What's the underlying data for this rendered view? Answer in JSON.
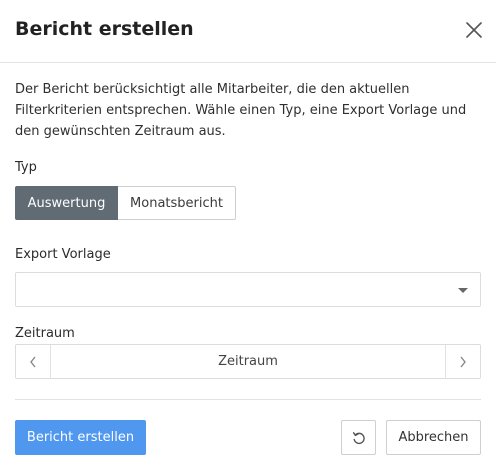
{
  "dialog": {
    "title": "Bericht erstellen",
    "close_icon": "close-icon"
  },
  "description": "Der Bericht berücksichtigt alle Mitarbeiter, die den aktuellen Filterkriterien entsprechen. Wähle einen Typ, eine Export Vorlage und den gewünschten Zeitraum aus.",
  "type_section": {
    "label": "Typ",
    "options": [
      "Auswertung",
      "Monatsbericht"
    ],
    "selected": "Auswertung"
  },
  "export_template": {
    "label": "Export Vorlage",
    "value": "",
    "caret_icon": "caret-down-icon"
  },
  "period": {
    "label": "Zeitraum",
    "value": "Zeitraum",
    "prev_icon": "chevron-left-icon",
    "next_icon": "chevron-right-icon"
  },
  "footer": {
    "create_label": "Bericht erstellen",
    "reset_icon": "reset-icon",
    "cancel_label": "Abbrechen"
  },
  "colors": {
    "primary": "#4f97ef",
    "segment_active": "#606b74"
  }
}
